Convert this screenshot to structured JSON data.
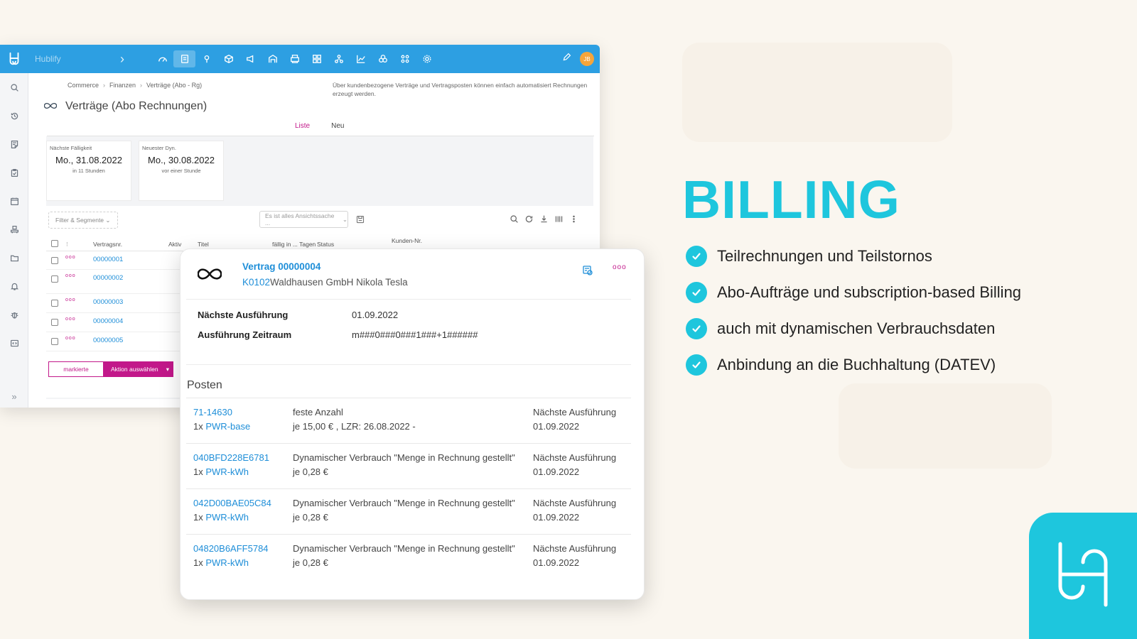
{
  "app": {
    "name": "Hublify",
    "avatar_initials": "JB",
    "accent_color": "#2d9fe2",
    "highlight_color": "#c2188a"
  },
  "nav_icons": [
    "dashboard-icon",
    "document-icon",
    "pin-icon",
    "box-icon",
    "megaphone-icon",
    "warehouse-icon",
    "printer-icon",
    "grid-icon",
    "network-icon",
    "chart-icon",
    "circles-icon",
    "apps-icon",
    "gear-icon"
  ],
  "sidebar_icons": [
    "search-icon",
    "history-icon",
    "note-icon",
    "clipboard-icon",
    "calendar-icon",
    "pallet-icon",
    "folder-icon",
    "bell-icon",
    "bug-icon",
    "code-icon"
  ],
  "breadcrumb": [
    "Commerce",
    "Finanzen",
    "Verträge (Abo - Rg)"
  ],
  "info_text": "Über kundenbezogene Verträge und Vertragsposten können einfach automatisiert Rechnungen erzeugt werden.",
  "page_title": "Verträge (Abo Rechnungen)",
  "tabs": [
    {
      "label": "Liste",
      "active": true
    },
    {
      "label": "Neu",
      "active": false
    }
  ],
  "stats": [
    {
      "label": "Nächste Fälligkeit",
      "value": "Mo., 31.08.2022",
      "sub": "in 11 Stunden"
    },
    {
      "label": "Neuester Dyn.",
      "value": "Mo., 30.08.2022",
      "sub": "vor einer Stunde"
    }
  ],
  "table": {
    "filter_placeholder": "Filter & Segmente",
    "view_select": "Es ist alles Ansichtssache ...",
    "columns": [
      "Vertragsnr.",
      "Aktiv",
      "Titel",
      "fällig in ... Tagen",
      "Status",
      "Kunden-Nr."
    ],
    "rows": [
      "00000001",
      "00000002",
      "00000003",
      "00000004",
      "00000005"
    ],
    "marked_button": "markierte",
    "action_button": "Aktion auswählen"
  },
  "detail": {
    "title": "Vertrag 00000004",
    "customer_id": "K0102",
    "customer_name": "Waldhausen GmbH Nikola Tesla",
    "fields": [
      {
        "label": "Nächste Ausführung",
        "value": "01.09.2022"
      },
      {
        "label": "Ausführung Zeitraum",
        "value": "m###0###0###1###+1######"
      }
    ],
    "posten_title": "Posten",
    "posten": [
      {
        "id": "71-14630",
        "qty": "1x",
        "sku": "PWR-base",
        "desc": "feste Anzahl",
        "price": "je 15,00 € , LZR: 26.08.2022 -",
        "next_label": "Nächste Ausführung",
        "next_date": "01.09.2022"
      },
      {
        "id": "040BFD228E6781",
        "qty": "1x",
        "sku": "PWR-kWh",
        "desc": "Dynamischer Verbrauch \"Menge in Rechnung gestellt\"",
        "price": "je 0,28 €",
        "next_label": "Nächste Ausführung",
        "next_date": "01.09.2022"
      },
      {
        "id": "042D00BAE05C84",
        "qty": "1x",
        "sku": "PWR-kWh",
        "desc": "Dynamischer Verbrauch \"Menge in Rechnung gestellt\"",
        "price": "je 0,28 €",
        "next_label": "Nächste Ausführung",
        "next_date": "01.09.2022"
      },
      {
        "id": "04820B6AFF5784",
        "qty": "1x",
        "sku": "PWR-kWh",
        "desc": "Dynamischer Verbrauch \"Menge in Rechnung gestellt\"",
        "price": "je 0,28 €",
        "next_label": "Nächste Ausführung",
        "next_date": "01.09.2022"
      }
    ]
  },
  "marketing": {
    "headline": "BILLING",
    "headline_color": "#1ec6dd",
    "features": [
      "Teilrechnungen und Teilstornos",
      "Abo-Aufträge und subscription-based Billing",
      "auch mit dynamischen Verbrauchsdaten",
      "Anbindung an die Buchhaltung (DATEV)"
    ]
  }
}
